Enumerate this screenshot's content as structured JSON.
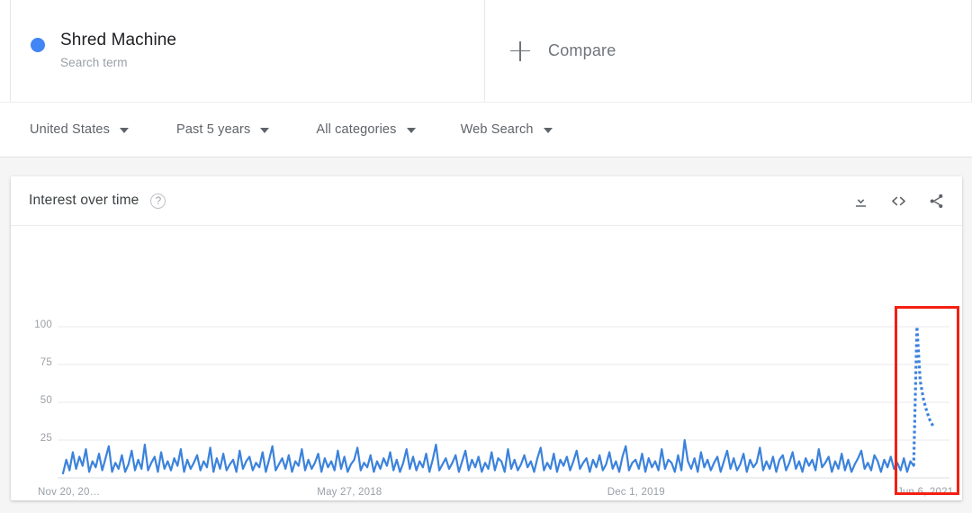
{
  "search_term": {
    "title": "Shred Machine",
    "subtitle": "Search term",
    "dot_color": "#4285f4"
  },
  "compare": {
    "label": "Compare",
    "icon": "plus-icon"
  },
  "filters": [
    {
      "label": "United States",
      "icon": "chevron-down-icon"
    },
    {
      "label": "Past 5 years",
      "icon": "chevron-down-icon"
    },
    {
      "label": "All categories",
      "icon": "chevron-down-icon"
    },
    {
      "label": "Web Search",
      "icon": "chevron-down-icon"
    }
  ],
  "card": {
    "title": "Interest over time",
    "help_icon": "?",
    "actions": [
      {
        "name": "download-icon",
        "label": "Download"
      },
      {
        "name": "embed-code-icon",
        "label": "Embed"
      },
      {
        "name": "share-icon",
        "label": "Share"
      }
    ]
  },
  "highlight": {
    "color": "#f32013",
    "note": "spike region"
  },
  "chart_data": {
    "type": "line",
    "title": "Interest over time",
    "xlabel": "",
    "ylabel": "",
    "ylim": [
      0,
      100
    ],
    "yticks": [
      25,
      50,
      75,
      100
    ],
    "grid": true,
    "legend": "none",
    "line_color": "#3b82dc",
    "dotted_tail": true,
    "x_tick_labels": [
      "Nov 20, 20…",
      "May 27, 2018",
      "Dec 1, 2019",
      "Jun 6, 2021"
    ],
    "x_tick_positions": [
      0,
      0.3333,
      0.6667,
      1.0
    ],
    "series": [
      {
        "name": "Shred Machine",
        "values": [
          3,
          12,
          5,
          17,
          6,
          14,
          8,
          19,
          4,
          11,
          7,
          16,
          5,
          13,
          21,
          4,
          10,
          6,
          15,
          4,
          9,
          18,
          5,
          12,
          6,
          22,
          5,
          10,
          14,
          4,
          17,
          6,
          11,
          5,
          13,
          8,
          19,
          4,
          12,
          6,
          10,
          15,
          5,
          11,
          7,
          20,
          4,
          13,
          6,
          16,
          5,
          9,
          12,
          4,
          18,
          6,
          11,
          14,
          5,
          10,
          7,
          17,
          4,
          12,
          21,
          5,
          9,
          13,
          6,
          15,
          4,
          11,
          8,
          19,
          5,
          12,
          6,
          10,
          16,
          4,
          13,
          7,
          11,
          5,
          18,
          6,
          14,
          4,
          9,
          12,
          20,
          5,
          10,
          7,
          15,
          4,
          11,
          6,
          13,
          8,
          17,
          5,
          12,
          4,
          10,
          19,
          6,
          14,
          5,
          11,
          7,
          16,
          4,
          12,
          22,
          5,
          9,
          13,
          6,
          10,
          15,
          4,
          11,
          18,
          5,
          12,
          7,
          14,
          4,
          10,
          6,
          17,
          5,
          13,
          11,
          4,
          19,
          6,
          12,
          5,
          9,
          15,
          7,
          11,
          4,
          13,
          20,
          5,
          10,
          6,
          16,
          4,
          12,
          8,
          14,
          5,
          11,
          18,
          6,
          10,
          13,
          4,
          12,
          7,
          15,
          5,
          9,
          17,
          6,
          11,
          4,
          14,
          21,
          5,
          10,
          12,
          6,
          16,
          4,
          13,
          7,
          11,
          5,
          19,
          6,
          12,
          10,
          4,
          15,
          5,
          25,
          11,
          6,
          13,
          4,
          17,
          7,
          12,
          5,
          10,
          14,
          4,
          11,
          18,
          6,
          13,
          5,
          9,
          16,
          4,
          12,
          7,
          10,
          20,
          5,
          11,
          6,
          14,
          4,
          12,
          15,
          5,
          10,
          17,
          6,
          11,
          4,
          13,
          8,
          12,
          5,
          19,
          7,
          10,
          14,
          4,
          11,
          6,
          16,
          5,
          12,
          4,
          9,
          13,
          18,
          6,
          10,
          5,
          15,
          11,
          4,
          12,
          7,
          14,
          6,
          10,
          5,
          13,
          4,
          11,
          8,
          100,
          64,
          52,
          44,
          38,
          34
        ],
        "peak_value": 100,
        "baseline_typical": 10
      }
    ],
    "annotations": [
      {
        "type": "rect-highlight",
        "color": "#f32013",
        "x_start_frac": 0.955,
        "x_end_frac": 1.03,
        "description": "red rectangle highlighting the terminal spike to 100"
      }
    ]
  }
}
